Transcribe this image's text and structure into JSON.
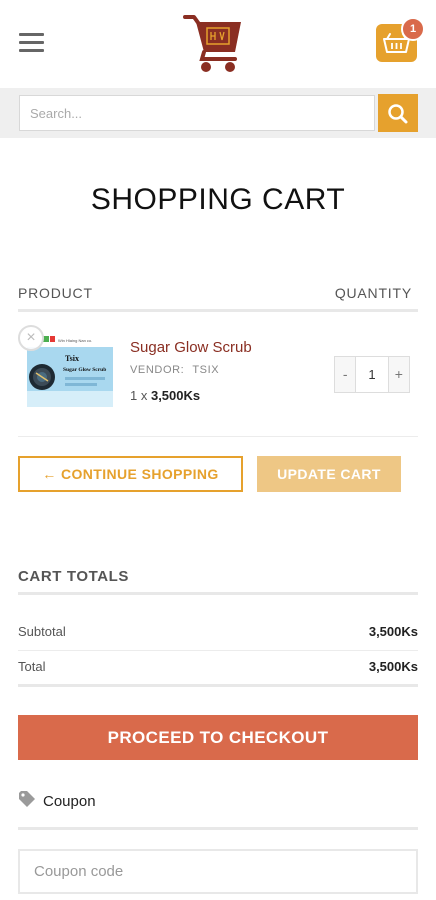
{
  "header": {
    "menu_icon": "hamburger-menu-icon",
    "logo_icon": "shopping-cart-logo",
    "cart_icon": "shopping-basket-icon",
    "cart_count": "1"
  },
  "search": {
    "placeholder": "Search...",
    "value": "",
    "button_icon": "search-icon"
  },
  "page": {
    "title": "SHOPPING CART"
  },
  "table": {
    "col_product": "PRODUCT",
    "col_quantity": "QUANTITY"
  },
  "cart_items": [
    {
      "name": "Sugar Glow Scrub",
      "vendor_label": "VENDOR:",
      "vendor": "TSIX",
      "qty_prefix": "1 x",
      "price": "3,500Ks",
      "quantity": "1",
      "qty_minus": "-",
      "qty_plus": "+",
      "remove_label": "×",
      "image_text_1": "Tsix",
      "image_text_2": "Sugar Glow Scrub"
    }
  ],
  "actions": {
    "continue_shopping": "← CONTINUE SHOPPING",
    "update_cart": "UPDATE CART"
  },
  "totals": {
    "title": "CART TOTALS",
    "subtotal_label": "Subtotal",
    "subtotal_value": "3,500Ks",
    "total_label": "Total",
    "total_value": "3,500Ks"
  },
  "checkout": {
    "label": "PROCEED TO CHECKOUT"
  },
  "coupon": {
    "label": "Coupon",
    "placeholder": "Coupon code",
    "value": ""
  },
  "colors": {
    "accent": "#e6a12d",
    "checkout": "#d96a4b",
    "brand": "#8a2e22"
  }
}
